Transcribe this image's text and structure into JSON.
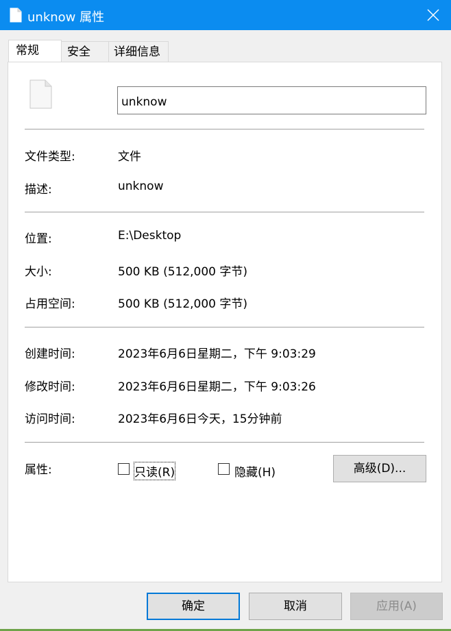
{
  "window": {
    "title": "unknow 属性",
    "close_label": "×"
  },
  "tabs": [
    {
      "label": "常规",
      "active": true
    },
    {
      "label": "安全",
      "active": false
    },
    {
      "label": "详细信息",
      "active": false
    }
  ],
  "general": {
    "file_name": "unknow",
    "file_type": {
      "label": "文件类型:",
      "value": "文件"
    },
    "description": {
      "label": "描述:",
      "value": "unknow"
    },
    "location": {
      "label": "位置:",
      "value": "E:\\Desktop"
    },
    "size": {
      "label": "大小:",
      "value": "500 KB (512,000 字节)"
    },
    "size_on_disk": {
      "label": "占用空间:",
      "value": "500 KB (512,000 字节)"
    },
    "created": {
      "label": "创建时间:",
      "value": "2023年6月6日星期二，下午 9:03:29"
    },
    "modified": {
      "label": "修改时间:",
      "value": "2023年6月6日星期二，下午 9:03:26"
    },
    "accessed": {
      "label": "访问时间:",
      "value": "2023年6月6日今天，15分钟前"
    },
    "attributes": {
      "label": "属性:",
      "readonly_label": "只读(R)",
      "readonly_checked": false,
      "hidden_label": "隐藏(H)",
      "hidden_checked": false,
      "advanced_button": "高级(D)..."
    }
  },
  "buttons": {
    "ok": "确定",
    "cancel": "取消",
    "apply": "应用(A)"
  },
  "colors": {
    "titlebar": "#0b8cf0",
    "default_button_border": "#0078d7",
    "panel": "#ffffff"
  }
}
